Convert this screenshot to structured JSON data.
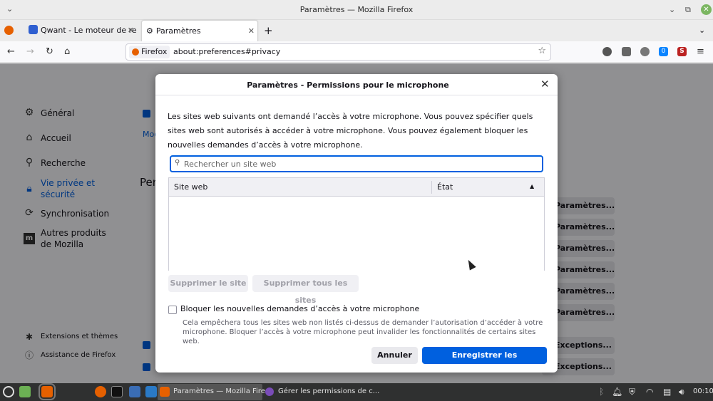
{
  "window": {
    "title": "Paramètres — Mozilla Firefox"
  },
  "tabs": [
    {
      "label": "Qwant - Le moteur de reche"
    },
    {
      "label": "Paramètres"
    }
  ],
  "navbar": {
    "identity": "Firefox",
    "url": "about:preferences#privacy",
    "badge": "0"
  },
  "sidebar": {
    "items": [
      {
        "label": "Général"
      },
      {
        "label": "Accueil"
      },
      {
        "label": "Recherche"
      },
      {
        "label": "Vie privée et sécurité"
      },
      {
        "label": "Synchronisation"
      },
      {
        "label": "Autres produits de Mozilla"
      }
    ],
    "footer": [
      {
        "label": "Extensions et thèmes"
      },
      {
        "label": "Assistance de Firefox"
      }
    ]
  },
  "background": {
    "heading_partial": "Per",
    "link_partial": "Moc",
    "settings_button": "Paramètres...",
    "exceptions_button": "Exceptions..."
  },
  "dialog": {
    "title": "Paramètres - Permissions pour le microphone",
    "description": "Les sites web suivants ont demandé l’accès à votre microphone. Vous pouvez spécifier quels sites web sont autorisés à accéder à votre microphone. Vous pouvez également bloquer les nouvelles demandes d’accès à votre microphone.",
    "search_placeholder": "Rechercher un site web",
    "columns": [
      "Site web",
      "État"
    ],
    "remove_site": "Supprimer le site",
    "remove_all": "Supprimer tous les sites",
    "block_label": "Bloquer les nouvelles demandes d’accès à votre microphone",
    "block_help": "Cela empêchera tous les sites web non listés ci-dessus de demander l’autorisation d’accéder à votre microphone. Bloquer l’accès à votre microphone peut invalider les fonctionnalités de certains sites web.",
    "cancel": "Annuler",
    "save": "Enregistrer les modifications"
  },
  "taskbar": {
    "active_window": "Paramètres — Mozilla Fire...",
    "other_window": "Gérer les permissions de c...",
    "clock": "00:10"
  },
  "colors": {
    "accent": "#0060df",
    "taskbar": "#2f3030"
  }
}
